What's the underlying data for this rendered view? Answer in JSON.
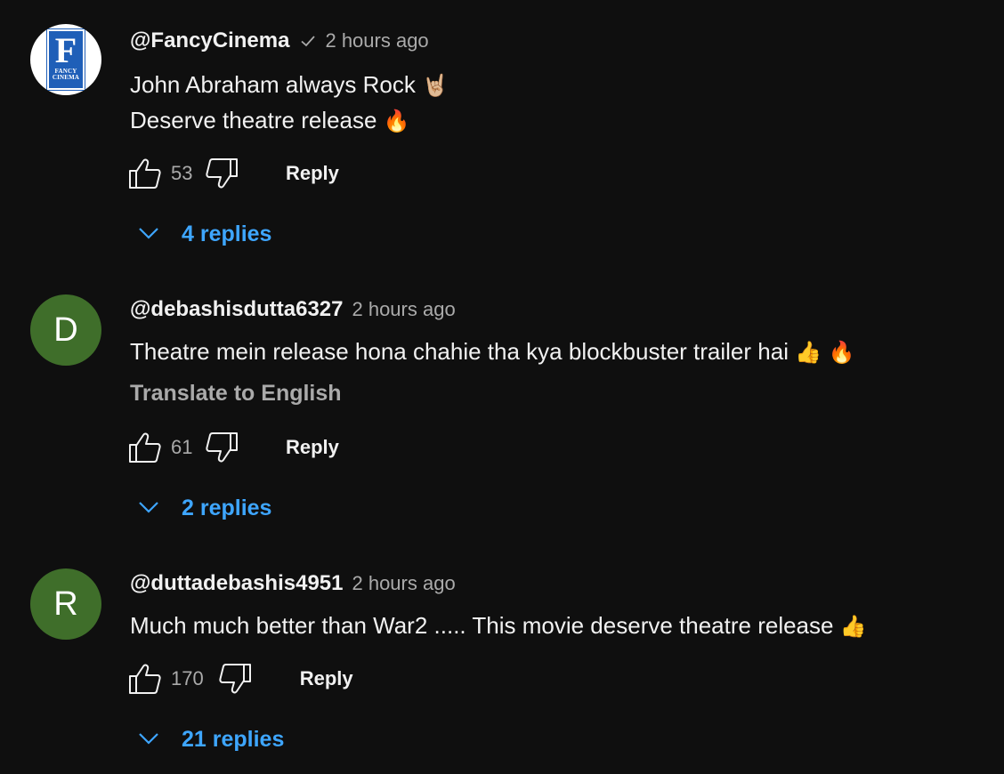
{
  "comments": [
    {
      "author": "@FancyCinema",
      "verified": true,
      "avatar": {
        "type": "logo",
        "letter": "F",
        "text": "FANCY CINEMA",
        "color": "#1f5fb8"
      },
      "time": "2 hours ago",
      "lines": [
        {
          "text": "John Abraham always Rock",
          "emoji": "🤘🏼"
        },
        {
          "text": "Deserve theatre release",
          "emoji": "🔥"
        }
      ],
      "likes": "53",
      "reply_label": "Reply",
      "replies_label": "4 replies"
    },
    {
      "author": "@debashisdutta6327",
      "verified": false,
      "avatar": {
        "type": "letter",
        "letter": "D",
        "color": "#3f6e2a"
      },
      "time": "2 hours ago",
      "lines": [
        {
          "text": "Theatre mein release hona chahie tha kya blockbuster trailer hai",
          "emoji": "👍 🔥"
        }
      ],
      "translate_label": "Translate to English",
      "likes": "61",
      "reply_label": "Reply",
      "replies_label": "2 replies"
    },
    {
      "author": "@duttadebashis4951",
      "verified": false,
      "avatar": {
        "type": "letter",
        "letter": "R",
        "color": "#3f6e2a"
      },
      "time": "2 hours ago",
      "lines": [
        {
          "text": "Much much better than War2 ..... This movie deserve theatre release",
          "emoji": "👍"
        }
      ],
      "likes": "170",
      "reply_label": "Reply",
      "replies_label": "21 replies"
    }
  ],
  "colors": {
    "background": "#0f0f0f",
    "primary_text": "#f1f1f1",
    "secondary_text": "#aaaaaa",
    "link_blue": "#3ea6ff",
    "avatar_green": "#3f6e2a"
  },
  "icons": {
    "like": "thumbs-up-icon",
    "dislike": "thumbs-down-icon",
    "expand": "chevron-down-icon",
    "verified": "checkmark-icon"
  }
}
